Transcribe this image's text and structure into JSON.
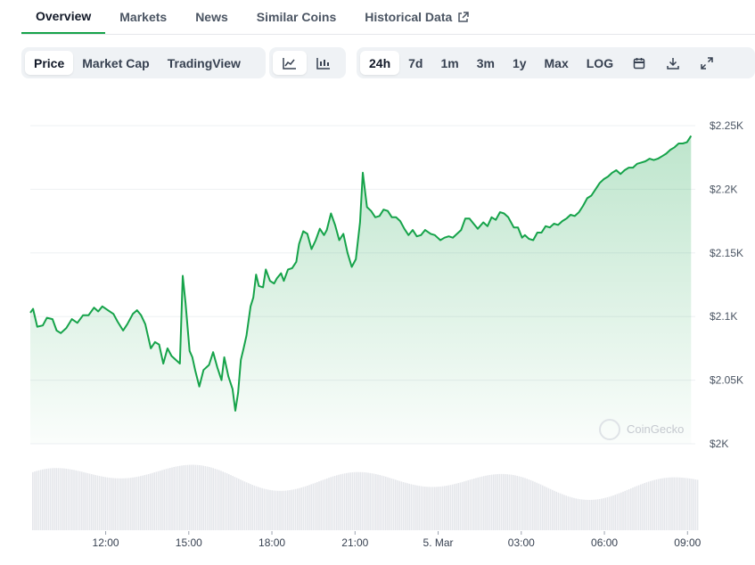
{
  "tabs": [
    "Overview",
    "Markets",
    "News",
    "Similar Coins",
    "Historical Data"
  ],
  "active_tab": "Overview",
  "toolbar": {
    "chart_types": [
      "Price",
      "Market Cap",
      "TradingView"
    ],
    "selected_chart_type": "Price",
    "views": [
      "line-chart-icon",
      "candlestick-chart-icon"
    ],
    "selected_view": "line-chart-icon",
    "ranges": [
      "24h",
      "7d",
      "1m",
      "3m",
      "1y",
      "Max",
      "LOG"
    ],
    "selected_range": "24h",
    "actions": [
      "calendar-icon",
      "download-icon",
      "fullscreen-icon"
    ]
  },
  "watermark": "CoinGecko",
  "colors": {
    "line": "#16a34a",
    "fill": "#16a34a",
    "volume": "#e5e7eb",
    "grid": "#eef0f3"
  },
  "chart_data": {
    "type": "line",
    "x_tick_labels": [
      "12:00",
      "15:00",
      "18:00",
      "21:00",
      "5. Mar",
      "03:00",
      "06:00",
      "09:00"
    ],
    "x_tick_hours": [
      2.72,
      5.72,
      8.72,
      11.72,
      14.72,
      17.72,
      20.72,
      23.72
    ],
    "y_tick_labels": [
      "$2K",
      "$2.05K",
      "$2.1K",
      "$2.15K",
      "$2.2K",
      "$2.25K"
    ],
    "y_ticks": [
      2000,
      2050,
      2100,
      2150,
      2200,
      2250
    ],
    "ylim": [
      2000,
      2250
    ],
    "xlim_hours": [
      0,
      24
    ],
    "grid": true,
    "legend": "none",
    "series": [
      {
        "values_hours": [
          [
            0.0,
            2103
          ],
          [
            0.1,
            2106
          ],
          [
            0.25,
            2092
          ],
          [
            0.45,
            2093
          ],
          [
            0.6,
            2099
          ],
          [
            0.8,
            2098
          ],
          [
            0.95,
            2089
          ],
          [
            1.1,
            2087
          ],
          [
            1.3,
            2091
          ],
          [
            1.5,
            2098
          ],
          [
            1.7,
            2095
          ],
          [
            1.9,
            2101
          ],
          [
            2.1,
            2101
          ],
          [
            2.3,
            2107
          ],
          [
            2.45,
            2104
          ],
          [
            2.6,
            2108
          ],
          [
            2.8,
            2105
          ],
          [
            3.0,
            2102
          ],
          [
            3.15,
            2096
          ],
          [
            3.35,
            2089
          ],
          [
            3.5,
            2094
          ],
          [
            3.7,
            2102
          ],
          [
            3.85,
            2105
          ],
          [
            4.0,
            2101
          ],
          [
            4.15,
            2094
          ],
          [
            4.35,
            2075
          ],
          [
            4.5,
            2080
          ],
          [
            4.65,
            2078
          ],
          [
            4.8,
            2063
          ],
          [
            4.95,
            2075
          ],
          [
            5.1,
            2069
          ],
          [
            5.25,
            2066
          ],
          [
            5.4,
            2063
          ],
          [
            5.5,
            2132
          ],
          [
            5.6,
            2111
          ],
          [
            5.75,
            2073
          ],
          [
            5.85,
            2068
          ],
          [
            5.95,
            2058
          ],
          [
            6.1,
            2045
          ],
          [
            6.25,
            2058
          ],
          [
            6.45,
            2062
          ],
          [
            6.6,
            2072
          ],
          [
            6.75,
            2060
          ],
          [
            6.9,
            2050
          ],
          [
            7.0,
            2068
          ],
          [
            7.15,
            2053
          ],
          [
            7.3,
            2043
          ],
          [
            7.4,
            2026
          ],
          [
            7.5,
            2040
          ],
          [
            7.6,
            2066
          ],
          [
            7.7,
            2075
          ],
          [
            7.8,
            2085
          ],
          [
            7.95,
            2108
          ],
          [
            8.05,
            2115
          ],
          [
            8.15,
            2133
          ],
          [
            8.25,
            2124
          ],
          [
            8.4,
            2123
          ],
          [
            8.5,
            2137
          ],
          [
            8.65,
            2128
          ],
          [
            8.8,
            2126
          ],
          [
            8.9,
            2130
          ],
          [
            9.05,
            2134
          ],
          [
            9.15,
            2128
          ],
          [
            9.3,
            2137
          ],
          [
            9.45,
            2138
          ],
          [
            9.6,
            2143
          ],
          [
            9.7,
            2157
          ],
          [
            9.85,
            2167
          ],
          [
            10.0,
            2165
          ],
          [
            10.15,
            2153
          ],
          [
            10.3,
            2160
          ],
          [
            10.45,
            2169
          ],
          [
            10.6,
            2164
          ],
          [
            10.7,
            2168
          ],
          [
            10.85,
            2181
          ],
          [
            11.0,
            2172
          ],
          [
            11.15,
            2160
          ],
          [
            11.3,
            2165
          ],
          [
            11.45,
            2150
          ],
          [
            11.6,
            2139
          ],
          [
            11.75,
            2145
          ],
          [
            11.9,
            2174
          ],
          [
            12.0,
            2213
          ],
          [
            12.15,
            2186
          ],
          [
            12.3,
            2183
          ],
          [
            12.45,
            2178
          ],
          [
            12.6,
            2179
          ],
          [
            12.75,
            2184
          ],
          [
            12.9,
            2183
          ],
          [
            13.05,
            2178
          ],
          [
            13.2,
            2178
          ],
          [
            13.35,
            2175
          ],
          [
            13.5,
            2169
          ],
          [
            13.65,
            2164
          ],
          [
            13.8,
            2168
          ],
          [
            13.95,
            2163
          ],
          [
            14.1,
            2164
          ],
          [
            14.25,
            2168
          ],
          [
            14.45,
            2165
          ],
          [
            14.6,
            2164
          ],
          [
            14.8,
            2160
          ],
          [
            14.95,
            2162
          ],
          [
            15.1,
            2163
          ],
          [
            15.25,
            2162
          ],
          [
            15.4,
            2165
          ],
          [
            15.55,
            2168
          ],
          [
            15.7,
            2177
          ],
          [
            15.85,
            2177
          ],
          [
            16.0,
            2173
          ],
          [
            16.15,
            2169
          ],
          [
            16.35,
            2174
          ],
          [
            16.5,
            2171
          ],
          [
            16.65,
            2178
          ],
          [
            16.8,
            2176
          ],
          [
            16.95,
            2182
          ],
          [
            17.1,
            2181
          ],
          [
            17.25,
            2178
          ],
          [
            17.45,
            2170
          ],
          [
            17.6,
            2170
          ],
          [
            17.75,
            2162
          ],
          [
            17.85,
            2164
          ],
          [
            18.0,
            2161
          ],
          [
            18.15,
            2160
          ],
          [
            18.3,
            2166
          ],
          [
            18.45,
            2166
          ],
          [
            18.6,
            2171
          ],
          [
            18.75,
            2170
          ],
          [
            18.9,
            2173
          ],
          [
            19.05,
            2172
          ],
          [
            19.2,
            2175
          ],
          [
            19.35,
            2177
          ],
          [
            19.5,
            2180
          ],
          [
            19.65,
            2179
          ],
          [
            19.8,
            2182
          ],
          [
            19.95,
            2187
          ],
          [
            20.1,
            2193
          ],
          [
            20.25,
            2195
          ],
          [
            20.4,
            2200
          ],
          [
            20.55,
            2205
          ],
          [
            20.7,
            2208
          ],
          [
            20.85,
            2210
          ],
          [
            21.0,
            2213
          ],
          [
            21.15,
            2215
          ],
          [
            21.3,
            2212
          ],
          [
            21.45,
            2215
          ],
          [
            21.6,
            2217
          ],
          [
            21.75,
            2217
          ],
          [
            21.9,
            2220
          ],
          [
            22.05,
            2221
          ],
          [
            22.2,
            2222
          ],
          [
            22.35,
            2224
          ],
          [
            22.5,
            2223
          ],
          [
            22.65,
            2224
          ],
          [
            22.8,
            2226
          ],
          [
            22.95,
            2228
          ],
          [
            23.1,
            2231
          ],
          [
            23.25,
            2233
          ],
          [
            23.4,
            2236
          ],
          [
            23.55,
            2236
          ],
          [
            23.7,
            2237
          ],
          [
            23.85,
            2242
          ]
        ]
      }
    ]
  }
}
